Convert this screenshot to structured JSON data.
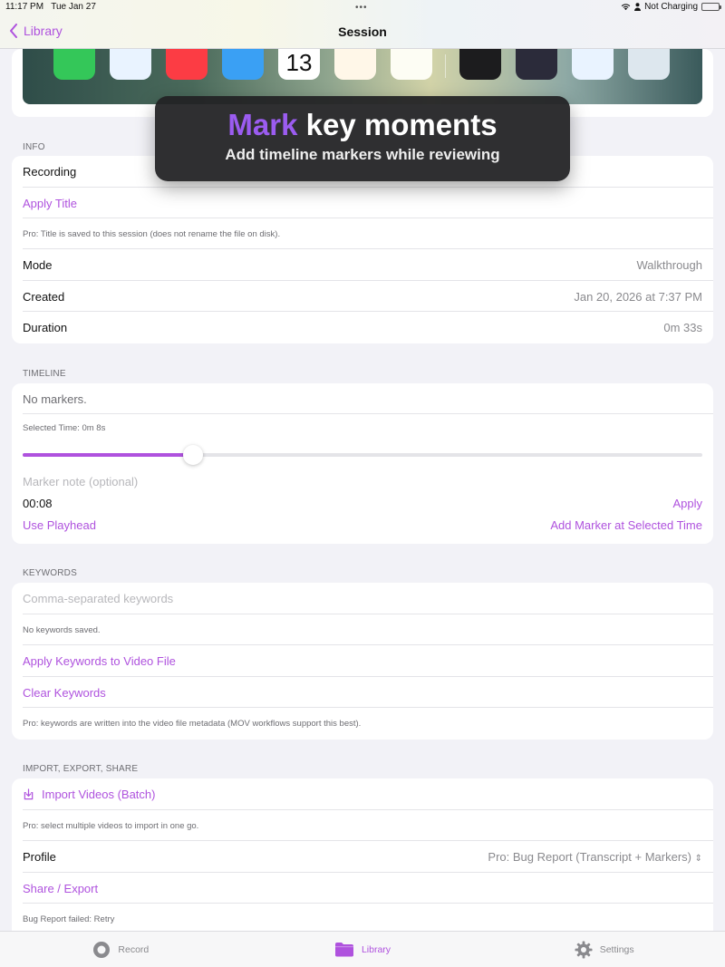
{
  "status_bar": {
    "time": "11:17 PM",
    "date": "Tue Jan 27",
    "dots": "•••",
    "power": "Not Charging"
  },
  "nav": {
    "back_label": "Library",
    "title": "Session"
  },
  "banner": {
    "highlight": "Mark",
    "headline_rest": " key moments",
    "subtitle": "Add timeline markers while reviewing"
  },
  "preview": {
    "calendar_day": "13"
  },
  "info": {
    "header": "INFO",
    "recording_label": "Recording",
    "apply_title": "Apply Title",
    "title_note": "Pro: Title is saved to this session (does not rename the file on disk).",
    "mode_label": "Mode",
    "mode_value": "Walkthrough",
    "created_label": "Created",
    "created_value": "Jan 20, 2026 at 7:37 PM",
    "duration_label": "Duration",
    "duration_value": "0m 33s"
  },
  "timeline": {
    "header": "TIMELINE",
    "no_markers": "No markers.",
    "selected_time": "Selected Time: 0m 8s",
    "slider_fraction": 0.25,
    "note_placeholder": "Marker note (optional)",
    "time_value": "00:08",
    "apply": "Apply",
    "use_playhead": "Use Playhead",
    "add_marker": "Add Marker at Selected Time"
  },
  "keywords": {
    "header": "KEYWORDS",
    "placeholder": "Comma-separated keywords",
    "none_saved": "No keywords saved.",
    "apply": "Apply Keywords to Video File",
    "clear": "Clear Keywords",
    "note": "Pro: keywords are written into the video file metadata (MOV workflows support this best)."
  },
  "import_export": {
    "header": "IMPORT, EXPORT, SHARE",
    "import_batch": "Import Videos (Batch)",
    "import_note": "Pro: select multiple videos to import in one go.",
    "profile_label": "Profile",
    "profile_value": "Pro: Bug Report (Transcript + Markers)",
    "share_export": "Share / Export",
    "bug_report_status": "Bug Report failed: Retry"
  },
  "tabs": [
    {
      "label": "Record",
      "icon": "record-icon"
    },
    {
      "label": "Library",
      "icon": "folder-icon"
    },
    {
      "label": "Settings",
      "icon": "gear-icon"
    }
  ],
  "colors": {
    "accent": "#af52de",
    "banner_highlight": "#9b5cf0",
    "background": "#f2f2f7"
  }
}
